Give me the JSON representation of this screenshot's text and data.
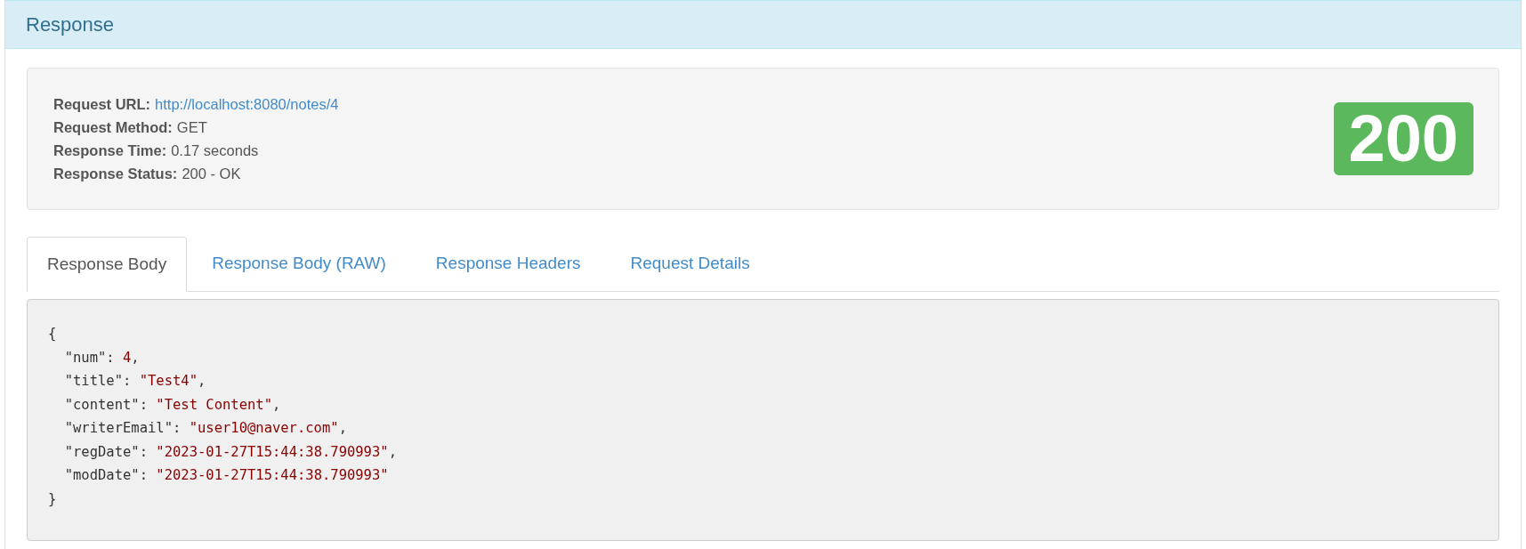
{
  "panel": {
    "title": "Response"
  },
  "info": [
    {
      "label": "Request URL:",
      "value": "http://localhost:8080/notes/4",
      "kind": "link"
    },
    {
      "label": "Request Method:",
      "value": "GET",
      "kind": "text"
    },
    {
      "label": "Response Time:",
      "value": "0.17 seconds",
      "kind": "text"
    },
    {
      "label": "Response Status:",
      "value": "200 - OK",
      "kind": "text"
    }
  ],
  "status_badge": "200",
  "tabs": [
    {
      "label": "Response Body",
      "selected": true
    },
    {
      "label": "Response Body (RAW)",
      "selected": false
    },
    {
      "label": "Response Headers",
      "selected": false
    },
    {
      "label": "Request Details",
      "selected": false
    }
  ],
  "code": [
    {
      "parts": [
        {
          "text": "{",
          "kind": "punct"
        }
      ]
    },
    {
      "parts": [
        {
          "text": "  \"num\": ",
          "kind": "punct"
        },
        {
          "text": "4",
          "kind": "value"
        },
        {
          "text": ",",
          "kind": "punct"
        }
      ]
    },
    {
      "parts": [
        {
          "text": "  \"title\": ",
          "kind": "punct"
        },
        {
          "text": "\"Test4\"",
          "kind": "value"
        },
        {
          "text": ",",
          "kind": "punct"
        }
      ]
    },
    {
      "parts": [
        {
          "text": "  \"content\": ",
          "kind": "punct"
        },
        {
          "text": "\"Test Content\"",
          "kind": "value"
        },
        {
          "text": ",",
          "kind": "punct"
        }
      ]
    },
    {
      "parts": [
        {
          "text": "  \"writerEmail\": ",
          "kind": "punct"
        },
        {
          "text": "\"user10@naver.com\"",
          "kind": "value"
        },
        {
          "text": ",",
          "kind": "punct"
        }
      ]
    },
    {
      "parts": [
        {
          "text": "  \"regDate\": ",
          "kind": "punct"
        },
        {
          "text": "\"2023-01-27T15:44:38.790993\"",
          "kind": "value"
        },
        {
          "text": ",",
          "kind": "punct"
        }
      ]
    },
    {
      "parts": [
        {
          "text": "  \"modDate\": ",
          "kind": "punct"
        },
        {
          "text": "\"2023-01-27T15:44:38.790993\"",
          "kind": "value"
        }
      ]
    },
    {
      "parts": [
        {
          "text": "}",
          "kind": "punct"
        }
      ]
    }
  ]
}
